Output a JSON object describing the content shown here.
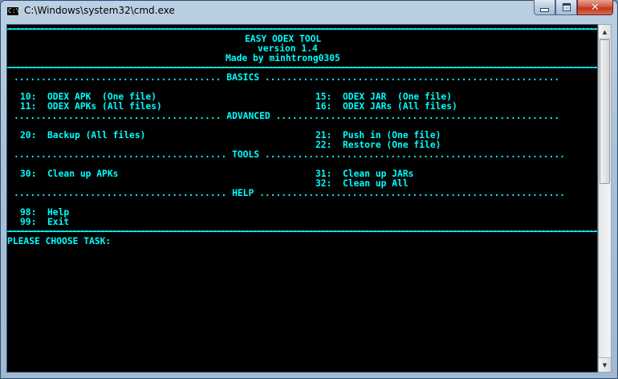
{
  "window": {
    "title": "C:\\Windows\\system32\\cmd.exe",
    "icon_label": "C:\\",
    "accent_color": "#00ffff"
  },
  "console": {
    "title": "EASY ODEX TOOL",
    "version": "version 1.4",
    "author": "Made by minhtrong0305",
    "sections": {
      "basics": "BASICS",
      "advanced": "ADVANCED",
      "tools": "TOOLS",
      "help": "HELP"
    },
    "menu": {
      "odex_apk": "10:  ODEX APK  (One file)",
      "odex_apks": "11:  ODEX APKs (All files)",
      "odex_jar": "15:  ODEX JAR  (One file)",
      "odex_jars": "16:  ODEX JARs (All files)",
      "backup": "20:  Backup (All files)",
      "push_in": "21:  Push in (One file)",
      "restore": "22:  Restore (One file)",
      "clean_apks": "30:  Clean up APKs",
      "clean_jars": "31:  Clean up JARs",
      "clean_all": "32:  Clean up All",
      "help": "98:  Help",
      "exit": "99:  Exit"
    },
    "prompt": "PLEASE CHOOSE TASK:"
  }
}
